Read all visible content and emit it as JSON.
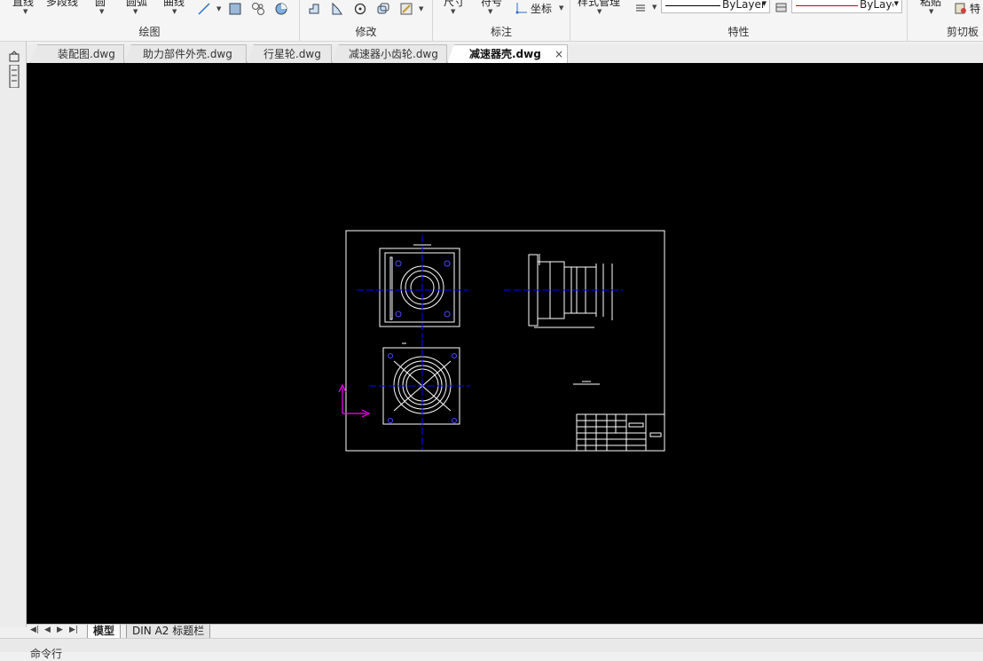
{
  "ribbon": {
    "draw": {
      "title": "绘图",
      "line": "直线",
      "polyline": "多段线",
      "circle": "圆",
      "arc": "圆弧",
      "curve": "曲线"
    },
    "modify": {
      "title": "修改"
    },
    "annotation": {
      "title": "标注",
      "dimension": "尺寸",
      "symbol": "符号",
      "coordinate": "坐标"
    },
    "properties": {
      "title": "特性",
      "style_manager": "样式管理",
      "linetype": "ByLayer",
      "color": "ByLayer"
    },
    "clipboard": {
      "title": "剪切板",
      "paste": "粘贴",
      "special": "特"
    }
  },
  "tabs": [
    {
      "label": "装配图.dwg"
    },
    {
      "label": "助力部件外壳.dwg"
    },
    {
      "label": "行星轮.dwg"
    },
    {
      "label": "减速器小齿轮.dwg"
    },
    {
      "label": "减速器壳.dwg",
      "active": true
    }
  ],
  "tab_close": "×",
  "layout_tabs": [
    {
      "label": "模型",
      "active": true
    },
    {
      "label": "DIN A2 标题栏"
    }
  ],
  "nav_buttons": [
    "◀|",
    "◀",
    "▶",
    "▶|"
  ],
  "command_line": "命令行",
  "colors": {
    "canvas_bg": "#000000",
    "geometry": "#ffffff",
    "centerline": "#0000ff",
    "ucs": "#ff00ff",
    "linetype_red": "#d00000"
  },
  "icons": [
    "line-icon",
    "rectangle-icon",
    "hatch-icon",
    "fill-icon",
    "move-icon",
    "mirror-icon",
    "rotate-icon",
    "copy-icon",
    "edit-icon",
    "layer-icon",
    "paste-icon",
    "properties-icon",
    "ucs-icon"
  ]
}
